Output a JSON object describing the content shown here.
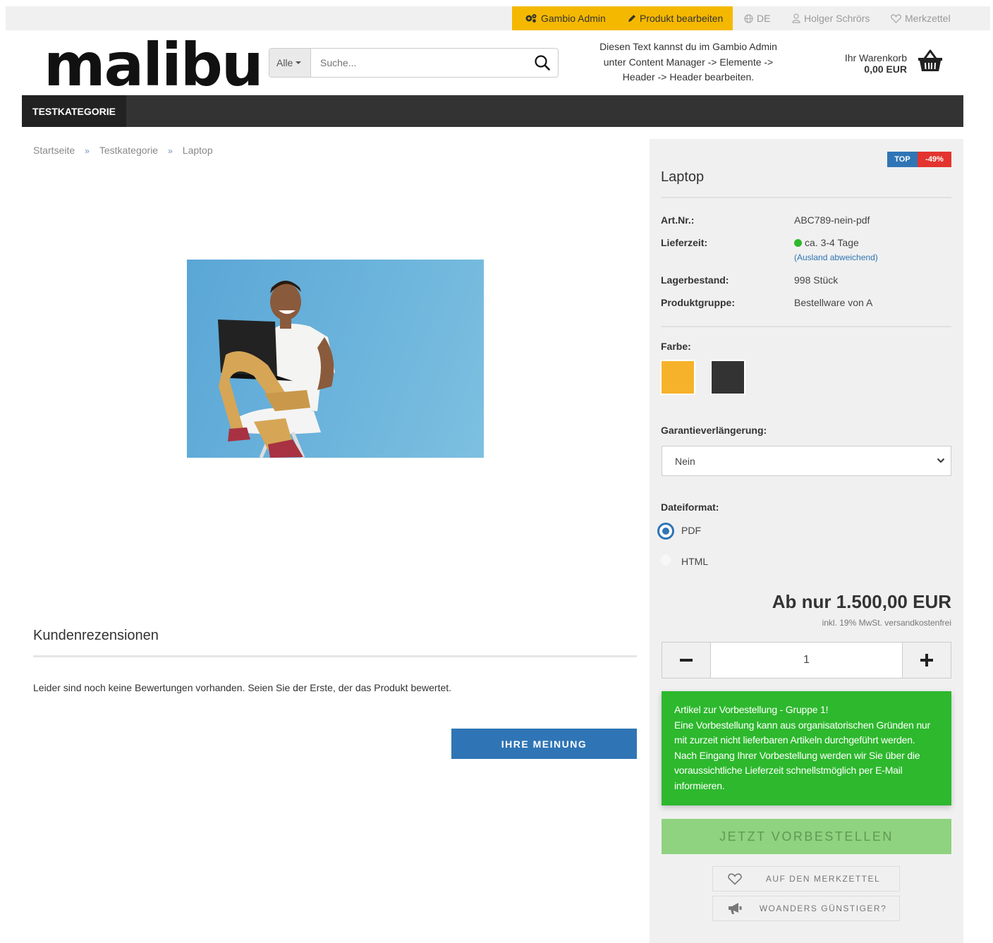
{
  "topbar": {
    "admin_label": "Gambio Admin",
    "edit_label": "Produkt bearbeiten",
    "language": "DE",
    "user": "Holger Schrörs",
    "wishlist": "Merkzettel"
  },
  "header": {
    "logo": "malibu",
    "search": {
      "category": "Alle",
      "placeholder": "Suche..."
    },
    "note_lines": [
      "Diesen Text kannst du im Gambio Admin",
      "unter Content Manager -> Elemente ->",
      "Header -> Header bearbeiten."
    ],
    "cart": {
      "label": "Ihr Warenkorb",
      "amount": "0,00 EUR"
    }
  },
  "nav": {
    "items": [
      "TESTKATEGORIE"
    ]
  },
  "breadcrumb": {
    "items": [
      "Startseite",
      "Testkategorie",
      "Laptop"
    ],
    "separator": "»"
  },
  "reviews": {
    "title": "Kundenrezensionen",
    "empty_text": "Leider sind noch keine Bewertungen vorhanden. Seien Sie der Erste, der das Produkt bewertet.",
    "button": "IHRE MEINUNG"
  },
  "product": {
    "badges": {
      "top": "TOP",
      "sale": "-49%"
    },
    "title": "Laptop",
    "attributes": {
      "art_nr": {
        "label": "Art.Nr.:",
        "value": "ABC789-nein-pdf"
      },
      "lieferzeit": {
        "label": "Lieferzeit:",
        "value": "ca. 3-4 Tage",
        "note": "(Ausland abweichend)"
      },
      "lager": {
        "label": "Lagerbestand:",
        "value": "998 Stück"
      },
      "gruppe": {
        "label": "Produktgruppe:",
        "value": "Bestellware von A"
      }
    },
    "color": {
      "label": "Farbe:",
      "swatches": [
        "#f6b22a",
        "#333333"
      ]
    },
    "warranty": {
      "label": "Garantieverlängerung:",
      "selected": "Nein"
    },
    "format": {
      "label": "Dateiformat:",
      "options": [
        "PDF",
        "HTML"
      ],
      "selected": "PDF"
    },
    "price": "Ab nur 1.500,00 EUR",
    "price_note": "inkl. 19% MwSt. versandkostenfrei",
    "quantity": "1",
    "preorder_notice": {
      "title": "Artikel zur Vorbestellung - Gruppe 1!",
      "text": "Eine Vorbestellung kann aus organisatorischen Gründen nur mit zurzeit nicht lieferbaren Artikeln durchgeführt werden. Nach Eingang Ihrer Vorbestellung werden wir Sie über die voraussichtliche Lieferzeit schnellstmöglich per E-Mail informieren."
    },
    "order_button": "JETZT VORBESTELLEN",
    "wishlist_button": "AUF DEN MERKZETTEL",
    "cheaper_button": "WOANDERS GÜNSTIGER?"
  },
  "colors": {
    "accent": "#2f75b5",
    "admin_bar": "#f5b800",
    "notice": "#2db82d",
    "nav": "#333333"
  }
}
